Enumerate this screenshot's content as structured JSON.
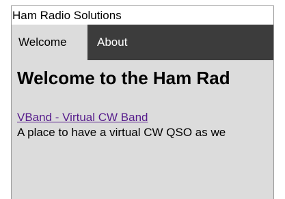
{
  "window": {
    "title": "Ham Radio Solutions"
  },
  "nav": {
    "tabs": [
      {
        "label": "Welcome",
        "active": true
      },
      {
        "label": "About",
        "active": false
      }
    ]
  },
  "main": {
    "heading": "Welcome to the Ham Rad",
    "links": [
      {
        "text": "VBand - Virtual CW Band",
        "description": "A place to have a virtual CW QSO as we"
      }
    ]
  },
  "colors": {
    "nav_background": "#3c3c3c",
    "content_background": "#dcdcdc",
    "visited_link": "#551a8b"
  }
}
